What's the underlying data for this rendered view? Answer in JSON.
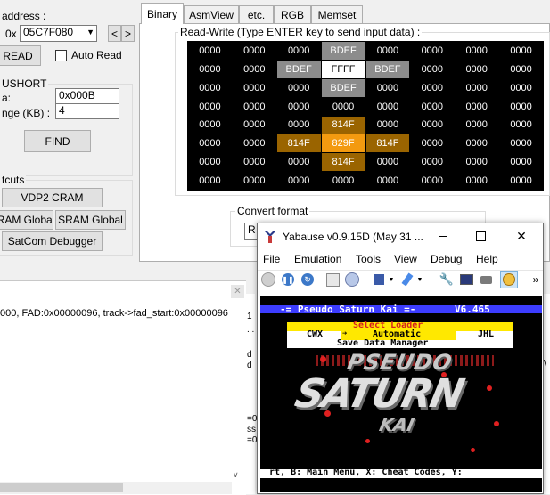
{
  "left_panel": {
    "address_label": "address :",
    "hex_prefix": "0x",
    "address_value": "05C7F080",
    "prev_button": "<",
    "next_button": ">",
    "read_button": "READ",
    "auto_read_label": "Auto Read",
    "search_group_label": "USHORT",
    "data_label": "a:",
    "data_value": "0x000B",
    "range_label": "nge (KB) :",
    "range_value": "4",
    "find_button": "FIND",
    "shortcuts_label": "tcuts",
    "vdp2_cram_button": "VDP2 CRAM",
    "cram_global_button": "RAM Global",
    "sram_global_button": "SRAM Global",
    "satcom_debugger_button": "SatCom Debugger"
  },
  "tabs": [
    "Binary",
    "AsmView",
    "etc.",
    "RGB",
    "Memset"
  ],
  "active_tab": "Binary",
  "read_write_label": "Read-Write (Type ENTER key to send input data) :",
  "memory_grid": [
    [
      "0000",
      "0000",
      "0000",
      "BDEF",
      "0000",
      "0000",
      "0000",
      "0000"
    ],
    [
      "0000",
      "0000",
      "BDEF",
      "FFFF",
      "BDEF",
      "0000",
      "0000",
      "0000"
    ],
    [
      "0000",
      "0000",
      "0000",
      "BDEF",
      "0000",
      "0000",
      "0000",
      "0000"
    ],
    [
      "0000",
      "0000",
      "0000",
      "0000",
      "0000",
      "0000",
      "0000",
      "0000"
    ],
    [
      "0000",
      "0000",
      "0000",
      "814F",
      "0000",
      "0000",
      "0000",
      "0000"
    ],
    [
      "0000",
      "0000",
      "814F",
      "829F",
      "814F",
      "0000",
      "0000",
      "0000"
    ],
    [
      "0000",
      "0000",
      "0000",
      "814F",
      "0000",
      "0000",
      "0000",
      "0000"
    ],
    [
      "0000",
      "0000",
      "0000",
      "0000",
      "0000",
      "0000",
      "0000",
      "0000"
    ]
  ],
  "convert_format_label": "Convert format",
  "convert_field_value": "R",
  "log_line": "000, FAD:0x00000096, track->fad_start:0x00000096",
  "bg_fragments": {
    "one": "1",
    "dots": ". .",
    "d1": "d",
    "d2": "d",
    "e1": "=0",
    "e2": "ss",
    "e3": "=0",
    "bslash": "\\"
  },
  "yabause": {
    "title": "Yabause v0.9.15D (May 31 ...",
    "menu": [
      "File",
      "Emulation",
      "Tools",
      "View",
      "Debug",
      "Help"
    ],
    "toolbar_more": "»",
    "screen": {
      "header": "-= Pseudo Saturn Kai =-",
      "version": "V6.465",
      "select_loader": "Select Loader",
      "cwx": "CWX",
      "automatic": "Automatic",
      "jhl": "JHL",
      "save_data": "Save Data Manager",
      "logo_line1": "PSEUDO",
      "logo_line2": "SATURN",
      "logo_line3": "KAI",
      "bottom": "rt, B: Main Menu, X: Cheat Codes, Y:"
    }
  },
  "colors": {
    "cell_highlight": "#8c8c8c",
    "cell_orange_dark": "#9a6400",
    "cell_orange_bright": "#f39a10",
    "screen_yellow": "#ffe800",
    "screen_blue": "#3d3dff"
  }
}
